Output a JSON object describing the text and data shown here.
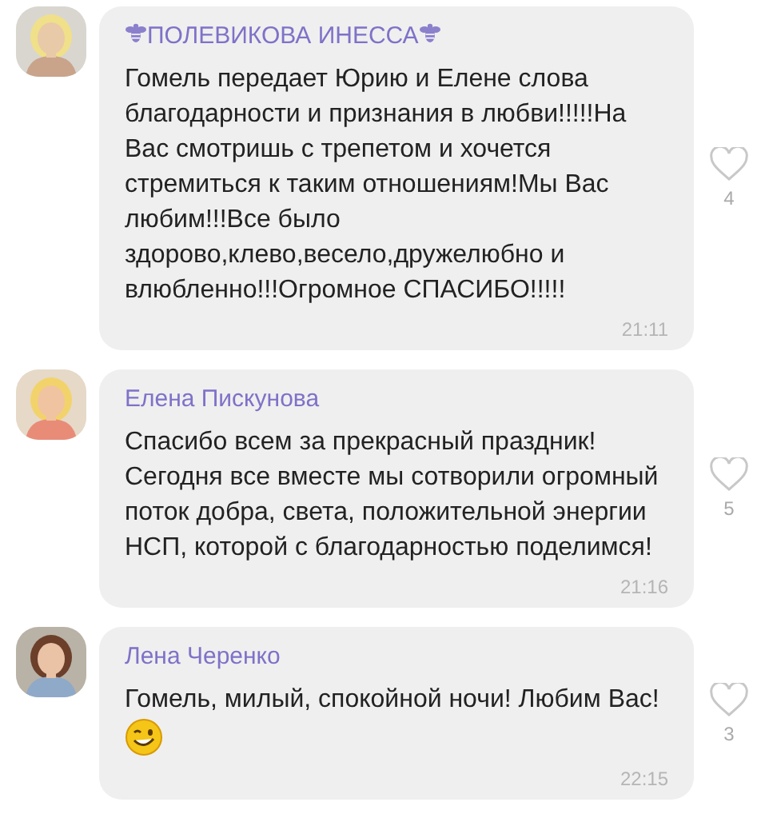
{
  "messages": [
    {
      "author": "ПОЛЕВИКОВА ИНЕССА",
      "author_icon": {
        "kind": "bee"
      },
      "text": "Гомель передает Юрию и Елене слова благодарности и признания в любви!!!!!На Вас смотришь с трепетом и хочется стремиться к таким отношениям!Мы Вас любим!!!Все было здорово,клево,весело,дружелюбно и влюбленно!!!Огромное СПАСИБО!!!!!",
      "time": "21:11",
      "likes": "4"
    },
    {
      "author": "Елена Пискунова",
      "text": "Спасибо всем за прекрасный праздник! Сегодня все вместе мы сотворили огромный поток добра, света, положительной энергии НСП, которой с благодарностью поделимся!",
      "time": "21:16",
      "likes": "5"
    },
    {
      "author": "Лена Черенко",
      "text": "Гомель, милый, спокойной ночи! Любим Вас!",
      "emoji": {
        "kind": "wink"
      },
      "time": "22:15",
      "likes": "3"
    }
  ]
}
